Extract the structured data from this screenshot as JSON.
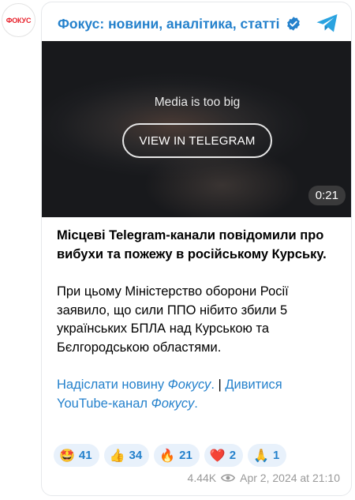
{
  "avatar": {
    "text": "ФОКУС",
    "brand_color": "#e8202a"
  },
  "header": {
    "channel_name": "Фокус: новини, аналітика, статті",
    "verified_icon": "verified-badge-icon",
    "telegram_icon": "telegram-logo-icon"
  },
  "media": {
    "message": "Media is too big",
    "button_label": "VIEW IN TELEGRAM",
    "duration": "0:21"
  },
  "post": {
    "headline": "Місцеві Telegram-канали повідомили про вибухи та пожежу в російському Курську.",
    "body": "При цьому Міністерство оборони Росії заявило, що сили ППО нібито збили 5 українських БПЛА над Курською та Бєлгородською областями.",
    "link1_text": "Надіслати новину ",
    "link1_italic": "Фокусу",
    "link1_end": ".",
    "separator": " | ",
    "link2_text": "Дивитися YouTube-канал ",
    "link2_italic": "Фокусу",
    "link2_end": "."
  },
  "reactions": [
    {
      "emoji": "🤩",
      "count": "41"
    },
    {
      "emoji": "👍",
      "count": "34"
    },
    {
      "emoji": "🔥",
      "count": "21"
    },
    {
      "emoji": "❤️",
      "count": "2"
    },
    {
      "emoji": "🙏",
      "count": "1"
    }
  ],
  "footer": {
    "views": "4.44K",
    "views_icon": "eye-icon",
    "date": "Apr 2, 2024 at 21:10"
  },
  "colors": {
    "link": "#2481cc",
    "reaction_bg": "#e8f1fb",
    "meta": "#999999"
  }
}
